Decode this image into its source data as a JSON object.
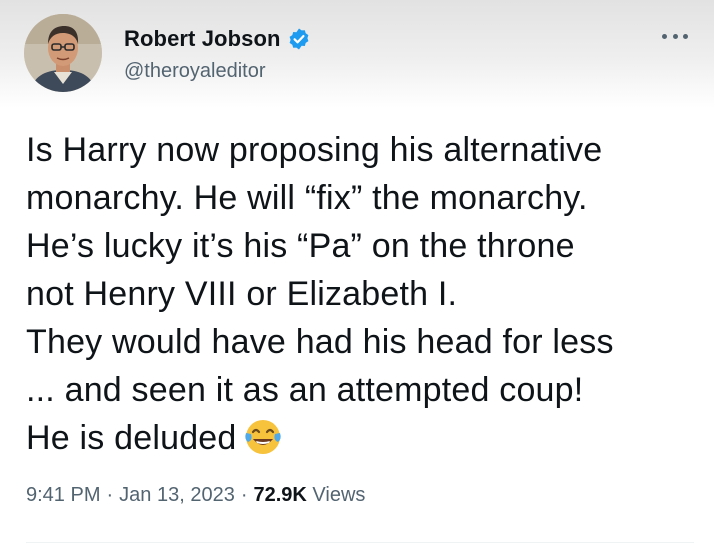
{
  "author": {
    "display_name": "Robert Jobson",
    "handle": "@theroyaleditor",
    "verified": true,
    "verified_icon": "verified-badge-icon",
    "avatar": "avatar-photo"
  },
  "menu_icon": "more-options-icon",
  "tweet": {
    "lines": [
      "Is Harry now proposing his alternative",
      "monarchy. He will “fix” the monarchy.",
      "He’s lucky it’s his “Pa” on the throne",
      "not Henry VIII or Elizabeth I.",
      "They would have had his head for less",
      "... and seen it as an attempted coup!",
      "He is deluded"
    ],
    "emoji": "face-with-tears-of-joy-icon"
  },
  "meta": {
    "time": "9:41 PM",
    "separator": "·",
    "date": "Jan 13, 2023",
    "views_count": "72.9K",
    "views_label": "Views"
  },
  "colors": {
    "text": "#0f1419",
    "secondary": "#536471",
    "verified": "#1d9bf0",
    "emoji_face": "#f7c23c",
    "tear": "#4fa8e8"
  }
}
